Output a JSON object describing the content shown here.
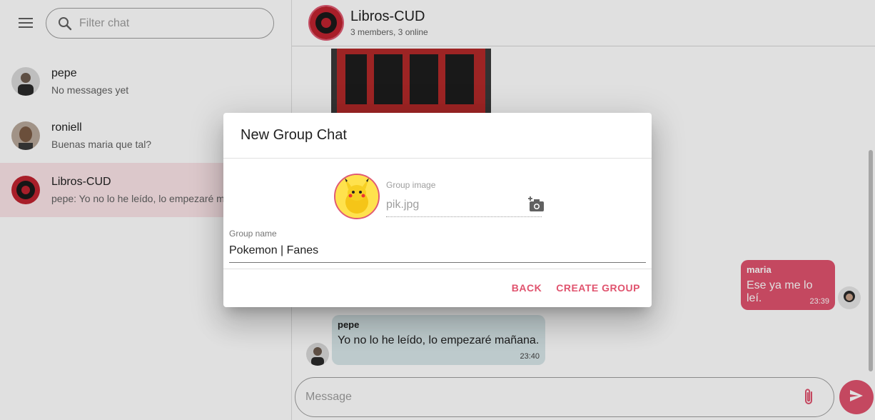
{
  "sidebar": {
    "filter_placeholder": "Filter chat",
    "chats": [
      {
        "name": "pepe",
        "last": "No messages yet"
      },
      {
        "name": "roniell",
        "last": "Buenas maria que tal?"
      },
      {
        "name": "Libros-CUD",
        "last": "pepe: Yo no lo he leído, lo empezaré mañana."
      }
    ]
  },
  "header": {
    "title": "Libros-CUD",
    "subtitle": "3 members, 3 online"
  },
  "messages": [
    {
      "author": "maria",
      "text": "Ese ya me lo leí.",
      "time": "23:39"
    },
    {
      "author": "pepe",
      "text": "Yo no lo he leído, lo empezaré mañana.",
      "time": "23:40"
    }
  ],
  "composer": {
    "placeholder": "Message"
  },
  "dialog": {
    "title": "New Group Chat",
    "image_label": "Group image",
    "image_value": "pik.jpg",
    "name_label": "Group name",
    "name_value": "Pokemon | Fanes",
    "back_label": "BACK",
    "create_label": "CREATE GROUP"
  },
  "colors": {
    "accent": "#e0536e",
    "active_chat_bg": "#fbe4e8",
    "their_bubble": "#d8e6e9"
  },
  "icons": [
    "menu-icon",
    "search-icon",
    "camera-add-icon",
    "attach-icon",
    "send-icon"
  ]
}
